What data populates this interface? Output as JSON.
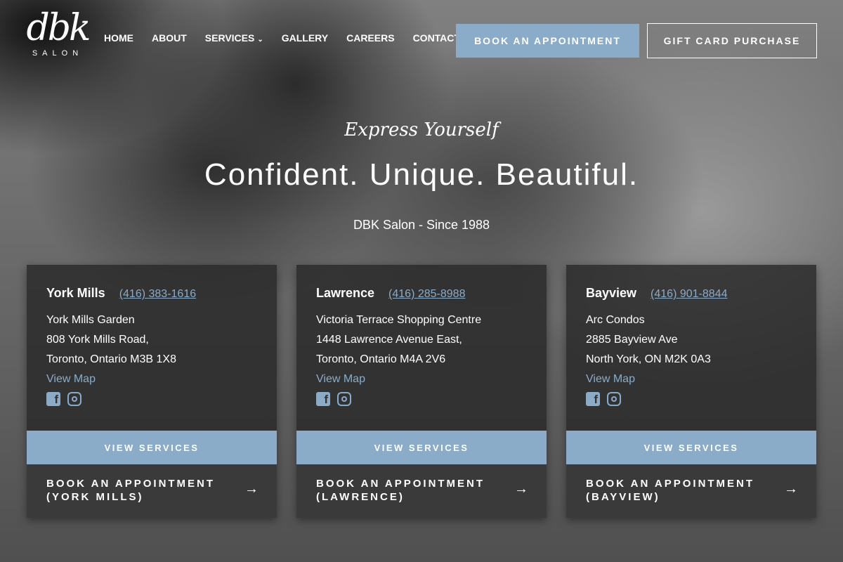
{
  "logo": {
    "mark": "dbk",
    "sub": "SALON"
  },
  "nav": {
    "items": [
      "HOME",
      "ABOUT",
      "SERVICES",
      "GALLERY",
      "CAREERS",
      "CONTACT"
    ],
    "book": "BOOK AN APPOINTMENT",
    "gift": "GIFT CARD PURCHASE"
  },
  "hero": {
    "tagline": "Express Yourself",
    "headline": "Confident. Unique. Beautiful.",
    "since": "DBK Salon - Since 1988"
  },
  "locations": [
    {
      "name": "York Mills",
      "phone": "(416) 383-1616",
      "lines": [
        "York Mills Garden",
        "808 York Mills Road,",
        "Toronto, Ontario M3B 1X8"
      ],
      "map": "View Map",
      "services": "VIEW SERVICES",
      "book1": "BOOK AN APPOINTMENT",
      "book2": "(YORK MILLS)"
    },
    {
      "name": "Lawrence",
      "phone": "(416) 285-8988",
      "lines": [
        "Victoria Terrace Shopping Centre",
        "1448 Lawrence Avenue East,",
        "Toronto, Ontario M4A 2V6"
      ],
      "map": "View Map",
      "services": "VIEW SERVICES",
      "book1": "BOOK AN APPOINTMENT",
      "book2": "(LAWRENCE)"
    },
    {
      "name": "Bayview",
      "phone": "(416) 901-8844",
      "lines": [
        "Arc Condos",
        "2885 Bayview Ave",
        "North York, ON M2K 0A3"
      ],
      "map": "View Map",
      "services": "VIEW SERVICES",
      "book1": "BOOK AN APPOINTMENT",
      "book2": "(BAYVIEW)"
    }
  ],
  "colors": {
    "accent": "#8aacc8"
  }
}
